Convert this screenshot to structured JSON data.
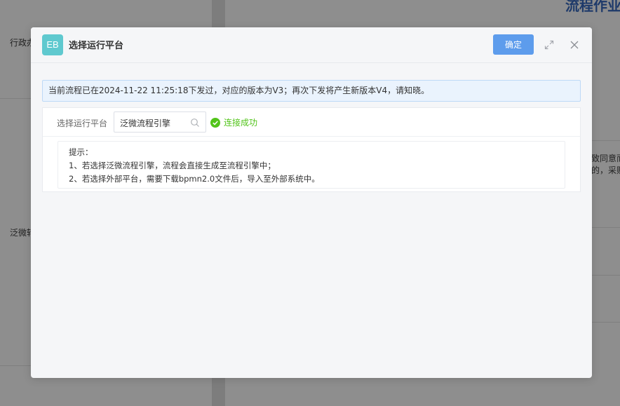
{
  "background": {
    "left_labels": [
      "行政办",
      "泛微转"
    ],
    "title_fragment": "流程作业",
    "snippets": [
      "致同意而",
      "的，采购"
    ]
  },
  "modal": {
    "logo_text": "EB",
    "title": "选择运行平台",
    "confirm_label": "确定",
    "notice": "当前流程已在2024-11-22 11:25:18下发过，对应的版本为V3；再次下发将产生新版本V4，请知晓。",
    "platform": {
      "label": "选择运行平台",
      "value": "泛微流程引擎",
      "status": "连接成功"
    },
    "tips": {
      "heading": "提示：",
      "line1": "1、若选择泛微流程引擎，流程会直接生成至流程引擎中；",
      "line2": "2、若选择外部平台，需要下载bpmn2.0文件后，导入至外部系统中。"
    }
  },
  "colors": {
    "accent": "#5d9cec",
    "logo": "#5fc9cf",
    "success": "#52c41a",
    "notice_bg": "#eaf3fd"
  }
}
